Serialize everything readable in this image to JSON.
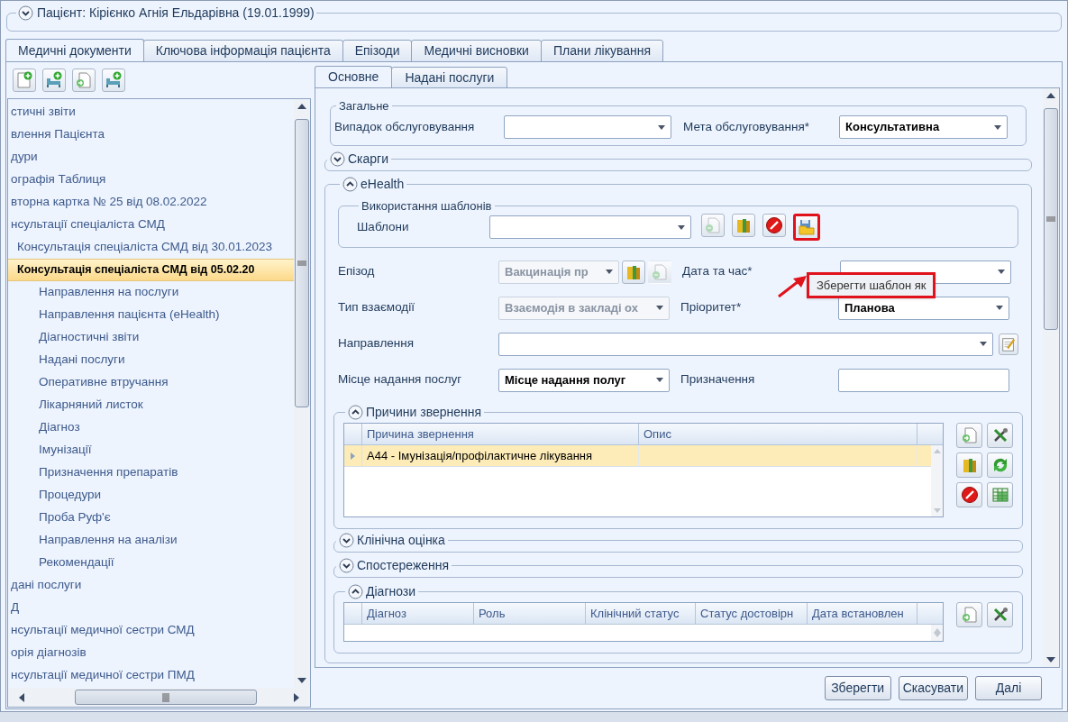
{
  "patient_header": {
    "title": "Пацієнт: Кірієнко Агнія Ельдарівна (19.01.1999)",
    "expanded": false
  },
  "tabs": [
    {
      "label": "Медичні документи",
      "selected": true
    },
    {
      "label": "Ключова інформація пацієнта",
      "selected": false
    },
    {
      "label": "Епізоди",
      "selected": false
    },
    {
      "label": "Медичні висновки",
      "selected": false
    },
    {
      "label": "Плани лікування",
      "selected": false
    }
  ],
  "tree": [
    {
      "label": "стичні звіти",
      "selected": false
    },
    {
      "label": "влення Пацієнта",
      "selected": false
    },
    {
      "label": "дури",
      "selected": false
    },
    {
      "label": "ографія Таблиця",
      "selected": false
    },
    {
      "label": "вторна картка № 25 від 08.02.2022",
      "selected": false
    },
    {
      "label": "нсультації спеціаліста СМД",
      "selected": false,
      "children": [
        {
          "label": "Консультація спеціаліста СМД від 30.01.2023",
          "selected": false
        },
        {
          "label": "Консультація спеціаліста СМД від 05.02.20",
          "selected": true,
          "children": [
            {
              "label": "Направлення на послуги",
              "selected": false
            },
            {
              "label": "Направлення пацієнта (eHealth)",
              "selected": false
            },
            {
              "label": "Діагностичні звіти",
              "selected": false
            },
            {
              "label": "Надані послуги",
              "selected": false
            },
            {
              "label": "Оперативне втручання",
              "selected": false
            },
            {
              "label": "Лікарняний листок",
              "selected": false
            },
            {
              "label": "Діагноз",
              "selected": false
            },
            {
              "label": "Імунізації",
              "selected": false
            },
            {
              "label": "Призначення препаратів",
              "selected": false
            },
            {
              "label": "Процедури",
              "selected": false
            },
            {
              "label": "Проба Руф'є",
              "selected": false
            },
            {
              "label": "Направлення на аналізи",
              "selected": false
            },
            {
              "label": "Рекомендації",
              "selected": false
            }
          ]
        }
      ]
    },
    {
      "label": "дані послуги",
      "selected": false
    },
    {
      "label": "Д",
      "selected": false
    },
    {
      "label": "нсультації медичної сестри СМД",
      "selected": false
    },
    {
      "label": "орія діагнозів",
      "selected": false
    },
    {
      "label": "нсультації медичної сестри ПМД",
      "selected": false
    }
  ],
  "inner_tabs": [
    {
      "label": "Основне",
      "selected": true
    },
    {
      "label": "Надані послуги",
      "selected": false
    }
  ],
  "general": {
    "title": "Загальне",
    "case": {
      "label": "Випадок обслуговування"
    },
    "goal": {
      "label": "Мета обслуговування*",
      "value": "Консультативна"
    }
  },
  "complaints": {
    "title": "Скарги",
    "expanded": false
  },
  "ehealth": {
    "title": "eHealth",
    "expanded": true,
    "templates": {
      "title": "Використання шаблонів",
      "label": "Шаблони",
      "tooltip": "Зберегти шаблон як"
    },
    "episode": {
      "label": "Епізод",
      "value": "Вакцинація пр",
      "disabled": true
    },
    "datetime": {
      "label": "Дата та час*"
    },
    "interaction": {
      "label": "Тип взаємодії",
      "value": "Взаємодія в закладі ох",
      "disabled": true
    },
    "priority": {
      "label": "Пріоритет*",
      "value": "Планова"
    },
    "referral": {
      "label": "Направлення"
    },
    "place": {
      "label": "Місце надання послуг",
      "value": "Місце надання полуг"
    },
    "purpose": {
      "label": "Призначення"
    },
    "reasons": {
      "title": "Причини звернення",
      "expanded": true,
      "columns": [
        "Причина звернення",
        "Опис"
      ],
      "rows": [
        {
          "cells": [
            "A44 - Імунізація/профілактичне лікування"
          ],
          "selected": true
        }
      ]
    },
    "clinical": {
      "title": "Клінічна оцінка",
      "expanded": false
    },
    "observations": {
      "title": "Спостереження",
      "expanded": false
    },
    "diagnoses": {
      "title": "Діагнози",
      "expanded": true,
      "columns": [
        "Діагноз",
        "Роль",
        "Клінічний статус",
        "Статус достовірн",
        "Дата встановлен"
      ]
    }
  },
  "buttons": [
    "Зберегти",
    "Скасувати",
    "Далі"
  ]
}
